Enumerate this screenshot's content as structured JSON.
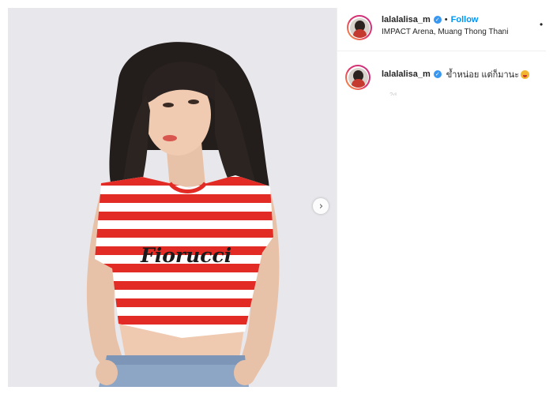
{
  "post": {
    "photo_alt": "photo",
    "next_glyph": "›",
    "shirt_logo_text": "Fiorucci"
  },
  "header": {
    "username": "lalalalisa_m",
    "verified_glyph": "✓",
    "separator": "•",
    "follow_label": "Follow",
    "location": "IMPACT Arena, Muang Thong Thani",
    "more_glyph": "•"
  },
  "caption": {
    "username": "lalalalisa_m",
    "verified_glyph": "✓",
    "text": "ข้ำหน่อย แต่ก็มานะ",
    "emoji": "tongue-out-face",
    "time": "2d"
  },
  "colors": {
    "accent": "#0095f6",
    "verified": "#3897f0",
    "shirt_red": "#e22b24"
  }
}
